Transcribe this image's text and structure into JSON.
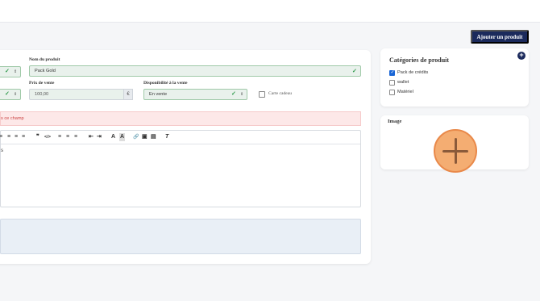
{
  "header": {
    "add_product_label": "Ajouter un produit"
  },
  "form": {
    "product_name_label": "Nom du produit",
    "product_name_value": "Pack Gold",
    "price_label": "Prix de vente",
    "price_value": "100,00",
    "currency": "€",
    "availability_label": "Disponibilité à la vente",
    "availability_value": "En vente",
    "gift_card_label": "Carte cadeau",
    "gift_card_checked": false,
    "error_text": "s ce champ"
  },
  "editor": {
    "toolbar": [
      "≡",
      "≡",
      "≡",
      "≡",
      "❞",
      "</>",
      "≡",
      "≡",
      "≡",
      "⇤",
      "⇥",
      "A",
      "A",
      "🔗",
      "▣",
      "▤",
      "T"
    ],
    "content": "s"
  },
  "categories": {
    "title": "Catégories de produit",
    "items": [
      {
        "label": "Pack de crédits",
        "checked": true
      },
      {
        "label": "wallet",
        "checked": false
      },
      {
        "label": "Matériel",
        "checked": false
      }
    ]
  },
  "image_panel": {
    "title": "Image"
  },
  "colors": {
    "accent": "#1b2a5c",
    "valid": "#2e9a4a",
    "error_bg": "#fde8e8",
    "upload": "#f4ad72"
  }
}
